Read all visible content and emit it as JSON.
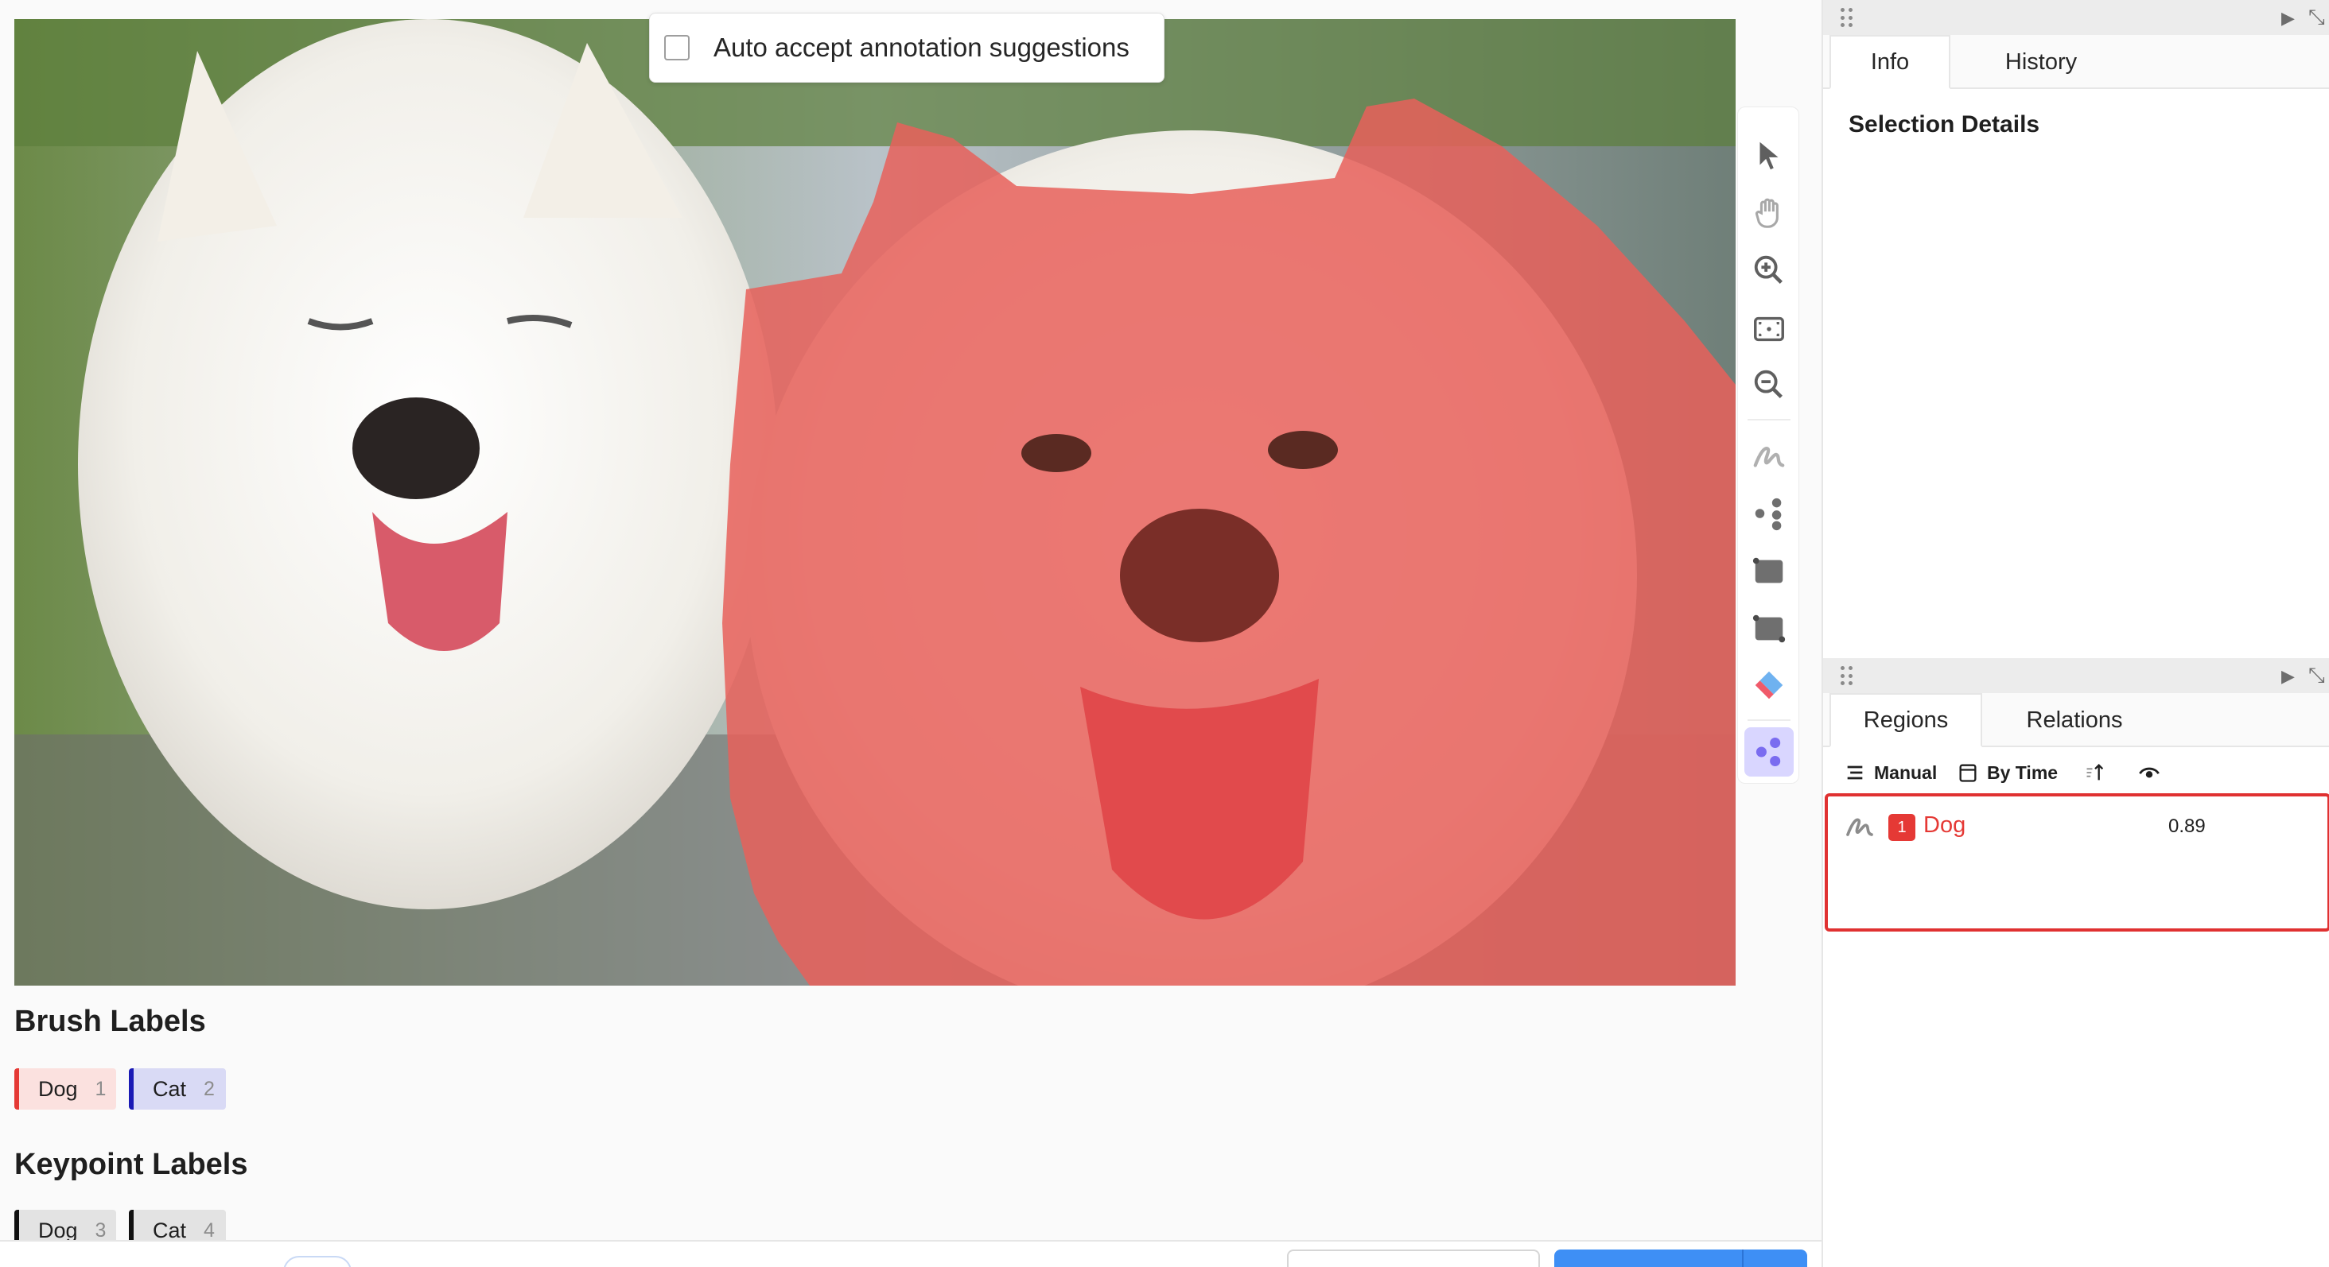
{
  "auto_accept": {
    "label": "Auto accept annotation suggestions",
    "checked": false
  },
  "toolbar": {
    "tools": [
      "select-icon",
      "pan-icon",
      "zoom-in-icon",
      "fit-icon",
      "zoom-out-icon",
      "brush-icon",
      "keypoint-icon",
      "rectangle-icon",
      "polygon-icon",
      "eraser-icon",
      "magic-wand-icon"
    ],
    "active_tool": "magic-wand-icon"
  },
  "brush_labels": {
    "title": "Brush Labels",
    "items": [
      {
        "label": "Dog",
        "hotkey": "1",
        "color": "#e53935"
      },
      {
        "label": "Cat",
        "hotkey": "2",
        "color": "#1a1ab5"
      }
    ]
  },
  "keypoint_labels": {
    "title": "Keypoint Labels",
    "items": [
      {
        "label": "Dog",
        "hotkey": "3",
        "color": "#111111"
      },
      {
        "label": "Cat",
        "hotkey": "4",
        "color": "#111111"
      }
    ]
  },
  "side_panel": {
    "top_tabs": [
      "Info",
      "History"
    ],
    "active_top_tab": "Info",
    "selection_details_title": "Selection Details",
    "bottom_tabs": [
      "Regions",
      "Relations"
    ],
    "active_bottom_tab": "Regions",
    "regions_toolbar": {
      "order": "Manual",
      "sort": "By Time"
    },
    "regions": [
      {
        "index": "1",
        "label": "Dog",
        "score": "0.89",
        "color": "#e53935",
        "type": "brush-icon"
      }
    ]
  },
  "colors": {
    "accent": "#3e8ff5",
    "dog": "#e53935",
    "cat": "#1a1ab5",
    "selection_border": "#e03131"
  }
}
